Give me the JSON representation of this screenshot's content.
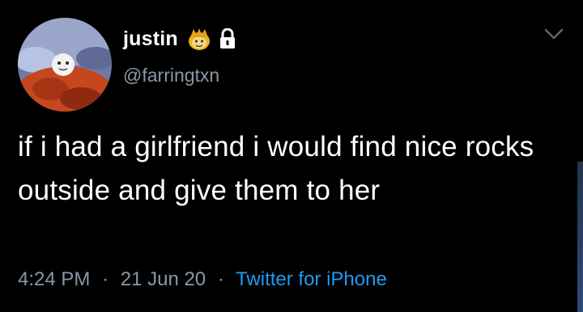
{
  "tweet": {
    "display_name": "justin",
    "handle": "@farringtxn",
    "text": "if i had a girlfriend i would find nice rocks outside and give them to her",
    "time": "4:24 PM",
    "date": "21 Jun 20",
    "separator": "·",
    "source": "Twitter for iPhone"
  },
  "icons": {
    "name_emoji": "lemon-crown-emoji-icon",
    "protected": "lock-icon",
    "menu": "chevron-down-icon"
  },
  "colors": {
    "background": "#000000",
    "text": "#ffffff",
    "secondary_text": "#8b98a5",
    "link": "#1d9bf0"
  }
}
